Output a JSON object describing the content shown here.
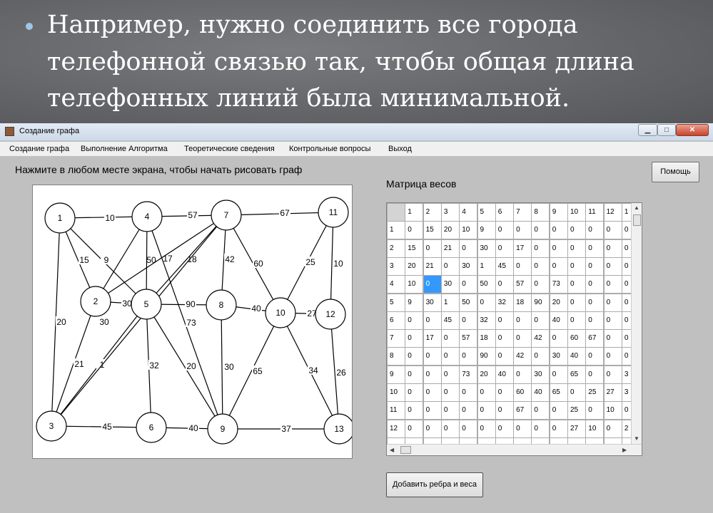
{
  "slide": {
    "lines": [
      "Например, нужно соединить все города",
      "телефонной связью так, чтобы общая длина",
      "телефонных линий была минимальной."
    ]
  },
  "window": {
    "title": "Создание графа",
    "buttons": [
      "▁",
      "□",
      "✕"
    ]
  },
  "menu": [
    "Создание графа",
    "Выполнение Алгоритма",
    "Теоретические сведения",
    "Контрольные вопросы",
    "Выход"
  ],
  "instruction": "Нажмите в любом месте экрана, чтобы начать рисовать граф",
  "help_button": "Помощь",
  "matrix_title": "Матрица весов",
  "add_button": "Добавить ребра и веса",
  "graph": {
    "nodes": [
      "1",
      "2",
      "3",
      "4",
      "5",
      "6",
      "7",
      "8",
      "9",
      "10",
      "11",
      "12",
      "13"
    ],
    "edges": [
      [
        "1",
        "4",
        "10"
      ],
      [
        "4",
        "7",
        "57"
      ],
      [
        "7",
        "11",
        "67"
      ],
      [
        "1",
        "2",
        "15"
      ],
      [
        "1",
        "5",
        "9"
      ],
      [
        "1",
        "3",
        "20"
      ],
      [
        "4",
        "2",
        "50"
      ],
      [
        "4",
        "5",
        "17"
      ],
      [
        "4",
        "9",
        "73"
      ],
      [
        "7",
        "2",
        "18"
      ],
      [
        "7",
        "5",
        "32"
      ],
      [
        "7",
        "8",
        "42"
      ],
      [
        "7",
        "10",
        "60"
      ],
      [
        "11",
        "10",
        "25"
      ],
      [
        "11",
        "12",
        "10"
      ],
      [
        "2",
        "5",
        "30"
      ],
      [
        "2",
        "3",
        "21"
      ],
      [
        "5",
        "3",
        "1"
      ],
      [
        "5",
        "8",
        "90"
      ],
      [
        "5",
        "6",
        "32"
      ],
      [
        "5",
        "9",
        "20"
      ],
      [
        "8",
        "10",
        "40"
      ],
      [
        "8",
        "9",
        "30"
      ],
      [
        "10",
        "12",
        "27"
      ],
      [
        "10",
        "9",
        "65"
      ],
      [
        "10",
        "13",
        "34"
      ],
      [
        "12",
        "13",
        "26"
      ],
      [
        "3",
        "6",
        "45"
      ],
      [
        "6",
        "9",
        "40"
      ],
      [
        "9",
        "13",
        "37"
      ],
      [
        "3",
        "7",
        "30"
      ]
    ]
  },
  "matrix": {
    "col_headers": [
      "1",
      "2",
      "3",
      "4",
      "5",
      "6",
      "7",
      "8",
      "9",
      "10",
      "11",
      "12",
      "1"
    ],
    "rows": [
      {
        "h": "1",
        "v": [
          "0",
          "15",
          "20",
          "10",
          "9",
          "0",
          "0",
          "0",
          "0",
          "0",
          "0",
          "0",
          "0"
        ]
      },
      {
        "h": "2",
        "v": [
          "15",
          "0",
          "21",
          "0",
          "30",
          "0",
          "17",
          "0",
          "0",
          "0",
          "0",
          "0",
          "0"
        ]
      },
      {
        "h": "3",
        "v": [
          "20",
          "21",
          "0",
          "30",
          "1",
          "45",
          "0",
          "0",
          "0",
          "0",
          "0",
          "0",
          "0"
        ]
      },
      {
        "h": "4",
        "v": [
          "10",
          "0",
          "30",
          "0",
          "50",
          "0",
          "57",
          "0",
          "73",
          "0",
          "0",
          "0",
          "0"
        ]
      },
      {
        "h": "5",
        "v": [
          "9",
          "30",
          "1",
          "50",
          "0",
          "32",
          "18",
          "90",
          "20",
          "0",
          "0",
          "0",
          "0"
        ]
      },
      {
        "h": "6",
        "v": [
          "0",
          "0",
          "45",
          "0",
          "32",
          "0",
          "0",
          "0",
          "40",
          "0",
          "0",
          "0",
          "0"
        ]
      },
      {
        "h": "7",
        "v": [
          "0",
          "17",
          "0",
          "57",
          "18",
          "0",
          "0",
          "42",
          "0",
          "60",
          "67",
          "0",
          "0"
        ]
      },
      {
        "h": "8",
        "v": [
          "0",
          "0",
          "0",
          "0",
          "90",
          "0",
          "42",
          "0",
          "30",
          "40",
          "0",
          "0",
          "0"
        ]
      },
      {
        "h": "9",
        "v": [
          "0",
          "0",
          "0",
          "73",
          "20",
          "40",
          "0",
          "30",
          "0",
          "65",
          "0",
          "0",
          "3"
        ]
      },
      {
        "h": "10",
        "v": [
          "0",
          "0",
          "0",
          "0",
          "0",
          "0",
          "60",
          "40",
          "65",
          "0",
          "25",
          "27",
          "3"
        ]
      },
      {
        "h": "11",
        "v": [
          "0",
          "0",
          "0",
          "0",
          "0",
          "0",
          "67",
          "0",
          "0",
          "25",
          "0",
          "10",
          "0"
        ]
      },
      {
        "h": "12",
        "v": [
          "0",
          "0",
          "0",
          "0",
          "0",
          "0",
          "0",
          "0",
          "0",
          "27",
          "10",
          "0",
          "2"
        ]
      }
    ],
    "selected": {
      "row": 3,
      "col": 1
    }
  },
  "colors": {
    "selection": "#3399ff",
    "window_bg": "#c0c0c0",
    "slide_bg": "#636467"
  }
}
